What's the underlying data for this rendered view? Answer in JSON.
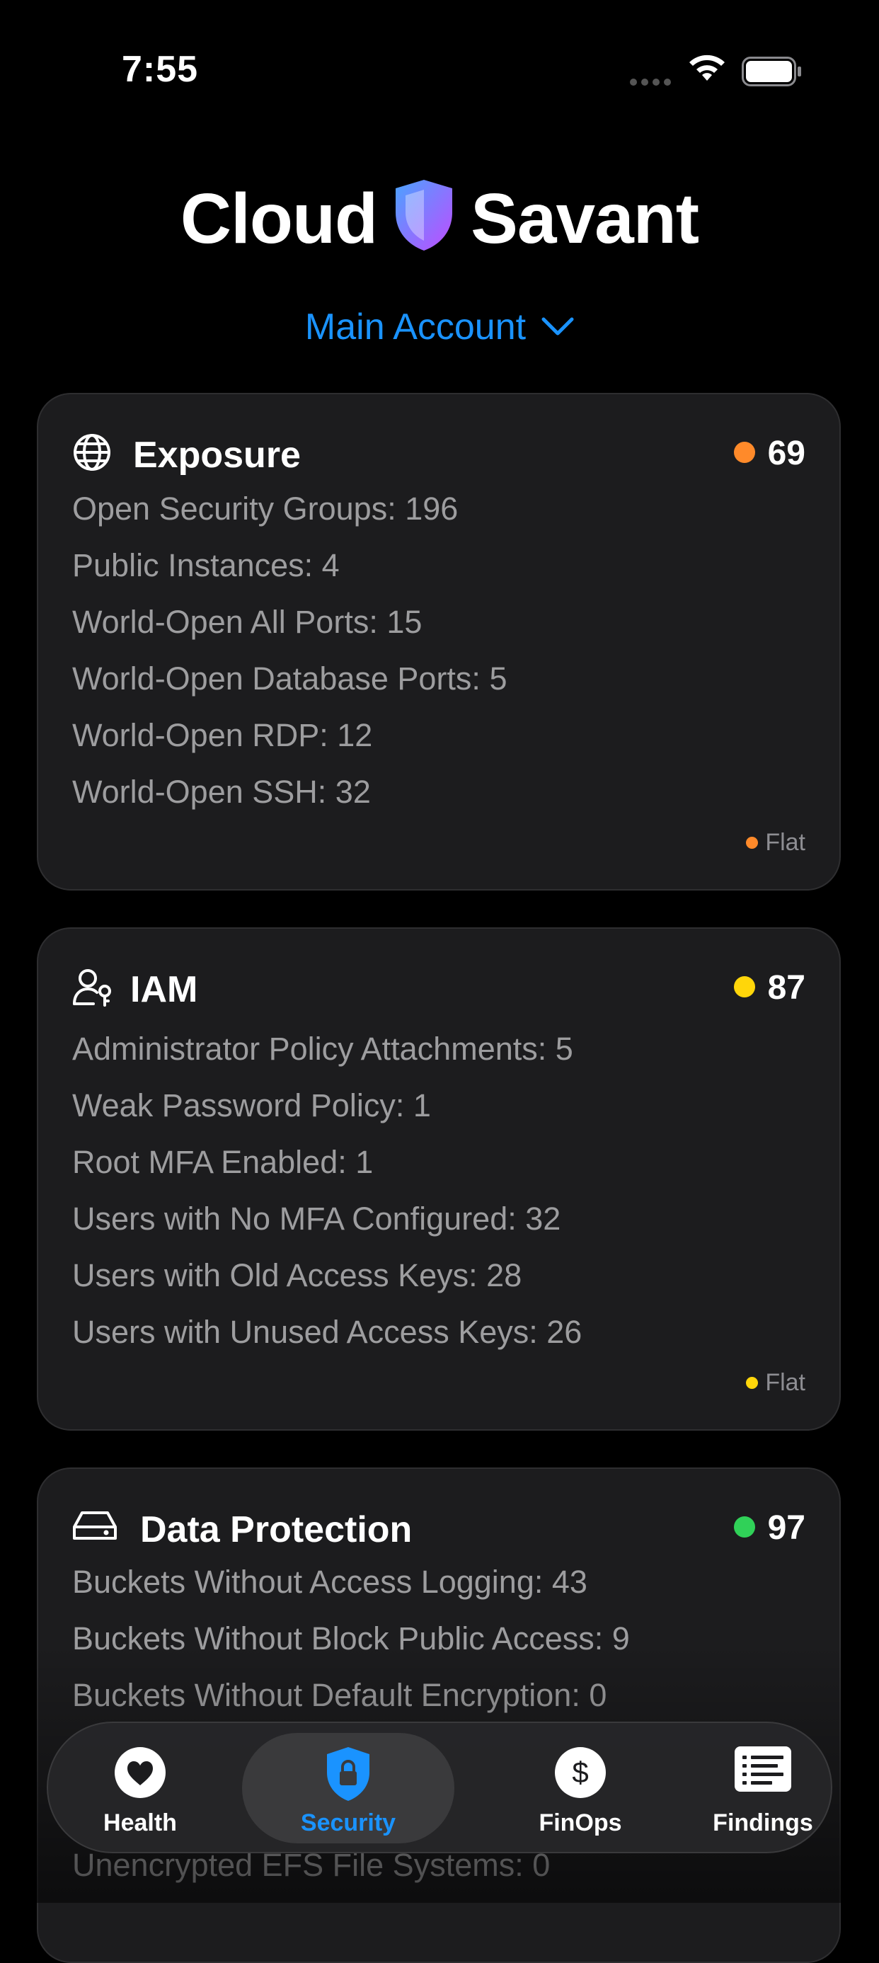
{
  "status_bar": {
    "time": "7:55"
  },
  "brand": {
    "word1": "Cloud",
    "word2": "Savant"
  },
  "account_selector": {
    "label": "Main Account"
  },
  "cards": [
    {
      "title": "Exposure",
      "icon": "globe-icon",
      "score": "69",
      "score_color": "#ff8a2a",
      "metrics": [
        "Open Security Groups: 196",
        "Public Instances: 4",
        "World-Open All Ports: 15",
        "World-Open Database Ports: 5",
        "World-Open RDP: 12",
        "World-Open SSH: 32"
      ],
      "trend": "Flat"
    },
    {
      "title": "IAM",
      "icon": "user-key-icon",
      "score": "87",
      "score_color": "#ffd60a",
      "metrics": [
        "Administrator Policy Attachments: 5",
        "Weak Password Policy: 1",
        "Root MFA Enabled: 1",
        "Users with No MFA Configured: 32",
        "Users with Old Access Keys: 28",
        "Users with Unused Access Keys: 26"
      ],
      "trend": "Flat"
    },
    {
      "title": "Data Protection",
      "icon": "drive-icon",
      "score": "97",
      "score_color": "#30d158",
      "metrics": [
        "Buckets Without Access Logging: 43",
        "Buckets Without Block Public Access: 9",
        "Buckets Without Default Encryption: 0",
        "Unencrypted EFS File Systems: 0"
      ]
    }
  ],
  "tabs": [
    {
      "label": "Health",
      "icon": "heart-icon"
    },
    {
      "label": "Security",
      "icon": "lock-shield-icon",
      "active": true
    },
    {
      "label": "FinOps",
      "icon": "dollar-icon"
    },
    {
      "label": "Findings",
      "icon": "list-icon"
    }
  ],
  "colors": {
    "accent": "#1a93ff",
    "card_bg": "#1c1c1e"
  }
}
